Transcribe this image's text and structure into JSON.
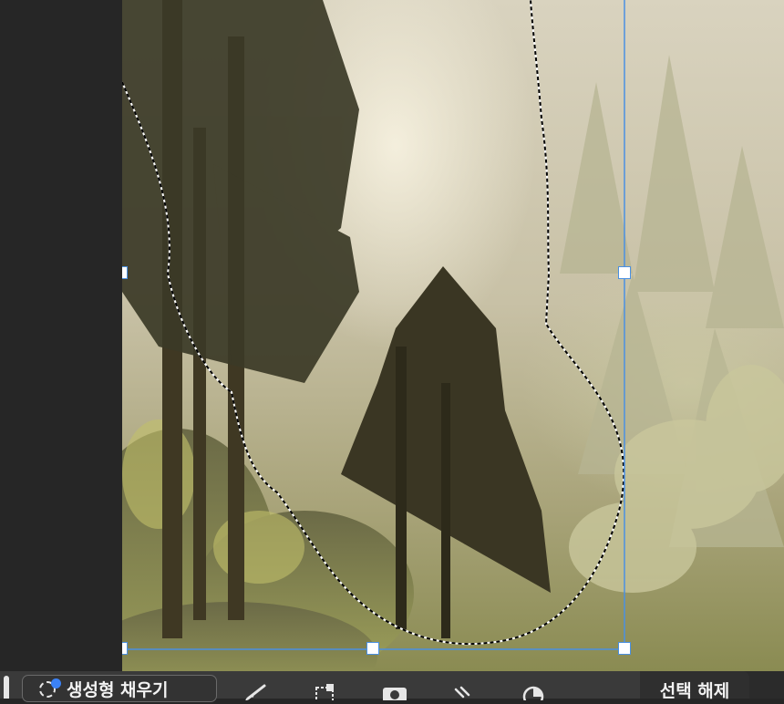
{
  "canvas": {
    "image_description_icon": "forest-photo",
    "selection_color": "#4a90e2"
  },
  "toolbar": {
    "generative_fill_label": "생성형 채우기",
    "deselect_label": "선택 해제",
    "icons": [
      "brush-icon",
      "crop-selection-icon",
      "mask-icon",
      "magic-wand-icon",
      "adjustment-icon"
    ]
  }
}
